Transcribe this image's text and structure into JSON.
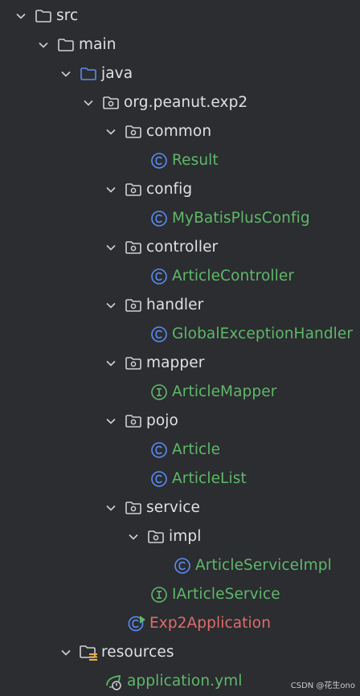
{
  "tree": [
    {
      "label": "src",
      "kind": "folder",
      "expanded": true
    },
    {
      "label": "main",
      "kind": "folder",
      "expanded": true
    },
    {
      "label": "java",
      "kind": "source-folder",
      "expanded": true
    },
    {
      "label": "org.peanut.exp2",
      "kind": "package",
      "expanded": true
    },
    {
      "label": "common",
      "kind": "package",
      "expanded": true
    },
    {
      "label": "Result",
      "kind": "class"
    },
    {
      "label": "config",
      "kind": "package",
      "expanded": true
    },
    {
      "label": "MyBatisPlusConfig",
      "kind": "class"
    },
    {
      "label": "controller",
      "kind": "package",
      "expanded": true
    },
    {
      "label": "ArticleController",
      "kind": "class"
    },
    {
      "label": "handler",
      "kind": "package",
      "expanded": true
    },
    {
      "label": "GlobalExceptionHandler",
      "kind": "class"
    },
    {
      "label": "mapper",
      "kind": "package",
      "expanded": true
    },
    {
      "label": "ArticleMapper",
      "kind": "interface"
    },
    {
      "label": "pojo",
      "kind": "package",
      "expanded": true
    },
    {
      "label": "Article",
      "kind": "class"
    },
    {
      "label": "ArticleList",
      "kind": "class"
    },
    {
      "label": "service",
      "kind": "package",
      "expanded": true
    },
    {
      "label": "impl",
      "kind": "package",
      "expanded": true
    },
    {
      "label": "ArticleServiceImpl",
      "kind": "class"
    },
    {
      "label": "IArticleService",
      "kind": "interface"
    },
    {
      "label": "Exp2Application",
      "kind": "spring-boot-class"
    },
    {
      "label": "resources",
      "kind": "resources-folder",
      "expanded": true
    },
    {
      "label": "application.yml",
      "kind": "yml"
    }
  ],
  "watermark": "CSDN @花生ono",
  "colors": {
    "background": "#2b2d30",
    "folder_text": "#dfe1e5",
    "class_text": "#5fb86a",
    "run_class_text": "#e06c6c",
    "class_icon": "#5b8bf7",
    "interface_icon": "#5fb86a",
    "folder_icon": "#cfd1d6",
    "source_folder_icon": "#5b8bf7"
  }
}
